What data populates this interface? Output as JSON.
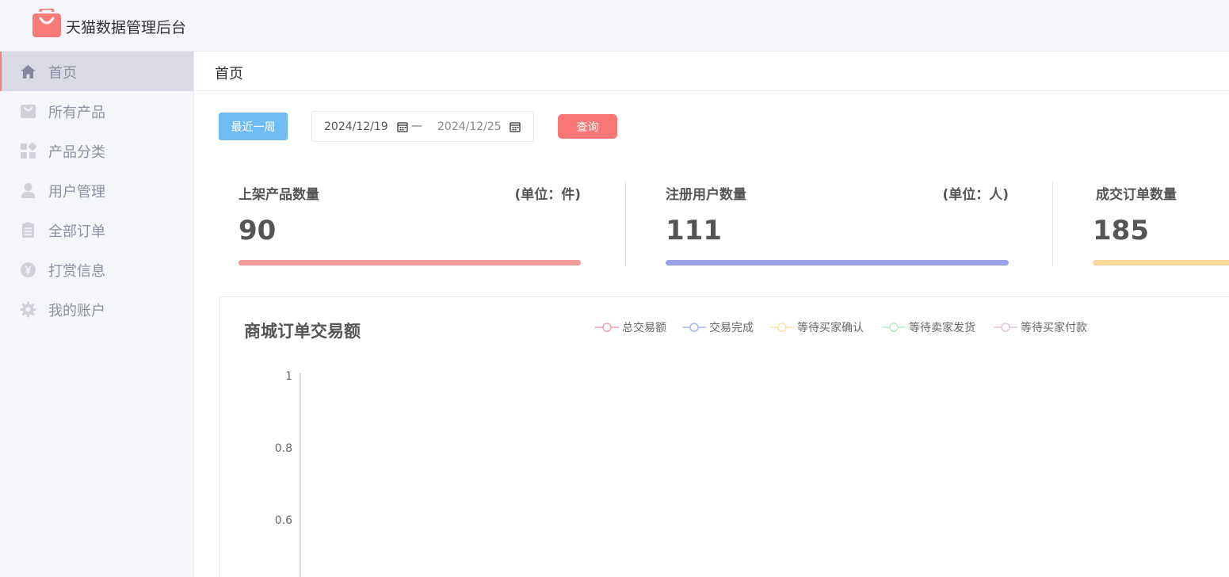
{
  "app": {
    "title": "天猫数据管理后台",
    "logo_icon": "shopping-bag-icon",
    "logo_color": "#f87b78"
  },
  "sidebar": {
    "items": [
      {
        "label": "首页",
        "icon": "home-icon",
        "active": true
      },
      {
        "label": "所有产品",
        "icon": "shopping-bag-icon",
        "active": false
      },
      {
        "label": "产品分类",
        "icon": "category-grid-icon",
        "active": false
      },
      {
        "label": "用户管理",
        "icon": "user-icon",
        "active": false
      },
      {
        "label": "全部订单",
        "icon": "clipboard-icon",
        "active": false
      },
      {
        "label": "打赏信息",
        "icon": "yen-coin-icon",
        "active": false
      },
      {
        "label": "我的账户",
        "icon": "gear-icon",
        "active": false
      }
    ]
  },
  "breadcrumb": {
    "current": "首页"
  },
  "filters": {
    "week_button": "最近一周",
    "start_date": "2024/12/19",
    "end_date": "2024/12/25",
    "separator": "—",
    "query_button": "查询"
  },
  "stats": [
    {
      "title": "上架产品数量",
      "unit": "(单位：件)",
      "value": "90",
      "color": "#f29a9a"
    },
    {
      "title": "注册用户数量",
      "unit": "(单位：人)",
      "value": "111",
      "color": "#9aa3ea"
    },
    {
      "title": "成交订单数量",
      "unit": "",
      "value": "185",
      "color": "#fad89a"
    }
  ],
  "chart_data": {
    "type": "line",
    "title": "商城订单交易额",
    "legend_position": "top",
    "series": [
      {
        "name": "总交易额",
        "color": "#f2a0a8",
        "values": []
      },
      {
        "name": "交易完成",
        "color": "#a9b4ee",
        "values": []
      },
      {
        "name": "等待买家确认",
        "color": "#fbe3a3",
        "values": []
      },
      {
        "name": "等待卖家发货",
        "color": "#b8ecc4",
        "values": []
      },
      {
        "name": "等待买家付款",
        "color": "#e7c4d8",
        "values": []
      }
    ],
    "y_ticks": [
      "1",
      "0.8",
      "0.6"
    ],
    "ylim": [
      0,
      1
    ]
  }
}
